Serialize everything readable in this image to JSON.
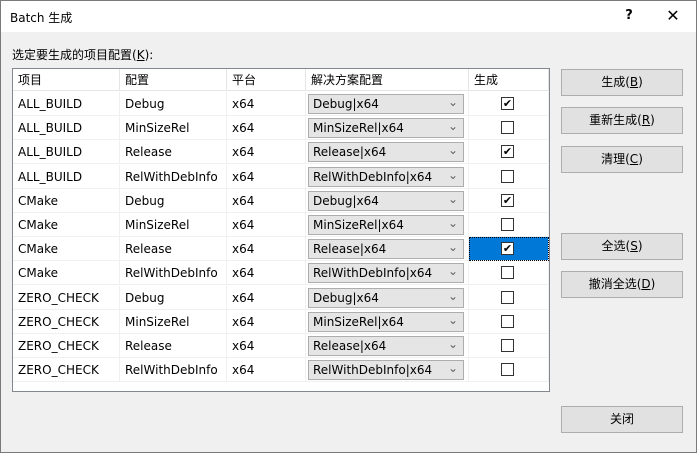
{
  "window": {
    "title": "Batch 生成",
    "help_label": "?",
    "close_glyph": "✕"
  },
  "prompt": {
    "text": "选定要生成的项目配置(",
    "mnemonic": "K",
    "suffix": "):"
  },
  "grid": {
    "headers": [
      "项目",
      "配置",
      "平台",
      "解决方案配置",
      "生成"
    ],
    "rows": [
      {
        "project": "ALL_BUILD",
        "config": "Debug",
        "platform": "x64",
        "solution_config": "Debug|x64",
        "build": true
      },
      {
        "project": "ALL_BUILD",
        "config": "MinSizeRel",
        "platform": "x64",
        "solution_config": "MinSizeRel|x64",
        "build": false
      },
      {
        "project": "ALL_BUILD",
        "config": "Release",
        "platform": "x64",
        "solution_config": "Release|x64",
        "build": true
      },
      {
        "project": "ALL_BUILD",
        "config": "RelWithDebInfo",
        "platform": "x64",
        "solution_config": "RelWithDebInfo|x64",
        "build": false
      },
      {
        "project": "CMake",
        "config": "Debug",
        "platform": "x64",
        "solution_config": "Debug|x64",
        "build": true
      },
      {
        "project": "CMake",
        "config": "MinSizeRel",
        "platform": "x64",
        "solution_config": "MinSizeRel|x64",
        "build": false
      },
      {
        "project": "CMake",
        "config": "Release",
        "platform": "x64",
        "solution_config": "Release|x64",
        "build": true,
        "selected": true
      },
      {
        "project": "CMake",
        "config": "RelWithDebInfo",
        "platform": "x64",
        "solution_config": "RelWithDebInfo|x64",
        "build": false
      },
      {
        "project": "ZERO_CHECK",
        "config": "Debug",
        "platform": "x64",
        "solution_config": "Debug|x64",
        "build": false
      },
      {
        "project": "ZERO_CHECK",
        "config": "MinSizeRel",
        "platform": "x64",
        "solution_config": "MinSizeRel|x64",
        "build": false
      },
      {
        "project": "ZERO_CHECK",
        "config": "Release",
        "platform": "x64",
        "solution_config": "Release|x64",
        "build": false
      },
      {
        "project": "ZERO_CHECK",
        "config": "RelWithDebInfo",
        "platform": "x64",
        "solution_config": "RelWithDebInfo|x64",
        "build": false
      }
    ]
  },
  "buttons": {
    "build": {
      "label": "生成(",
      "mnemonic": "B",
      "suffix": ")"
    },
    "rebuild": {
      "label": "重新生成(",
      "mnemonic": "R",
      "suffix": ")"
    },
    "clean": {
      "label": "清理(",
      "mnemonic": "C",
      "suffix": ")"
    },
    "select_all": {
      "label": "全选(",
      "mnemonic": "S",
      "suffix": ")"
    },
    "deselect_all": {
      "label": "撤消全选(",
      "mnemonic": "D",
      "suffix": ")"
    },
    "close": {
      "label": "关闭"
    }
  },
  "icons": {
    "dropdown": "chevron-down-icon",
    "check": "checkmark-icon"
  },
  "colors": {
    "selection": "#0078d7"
  }
}
